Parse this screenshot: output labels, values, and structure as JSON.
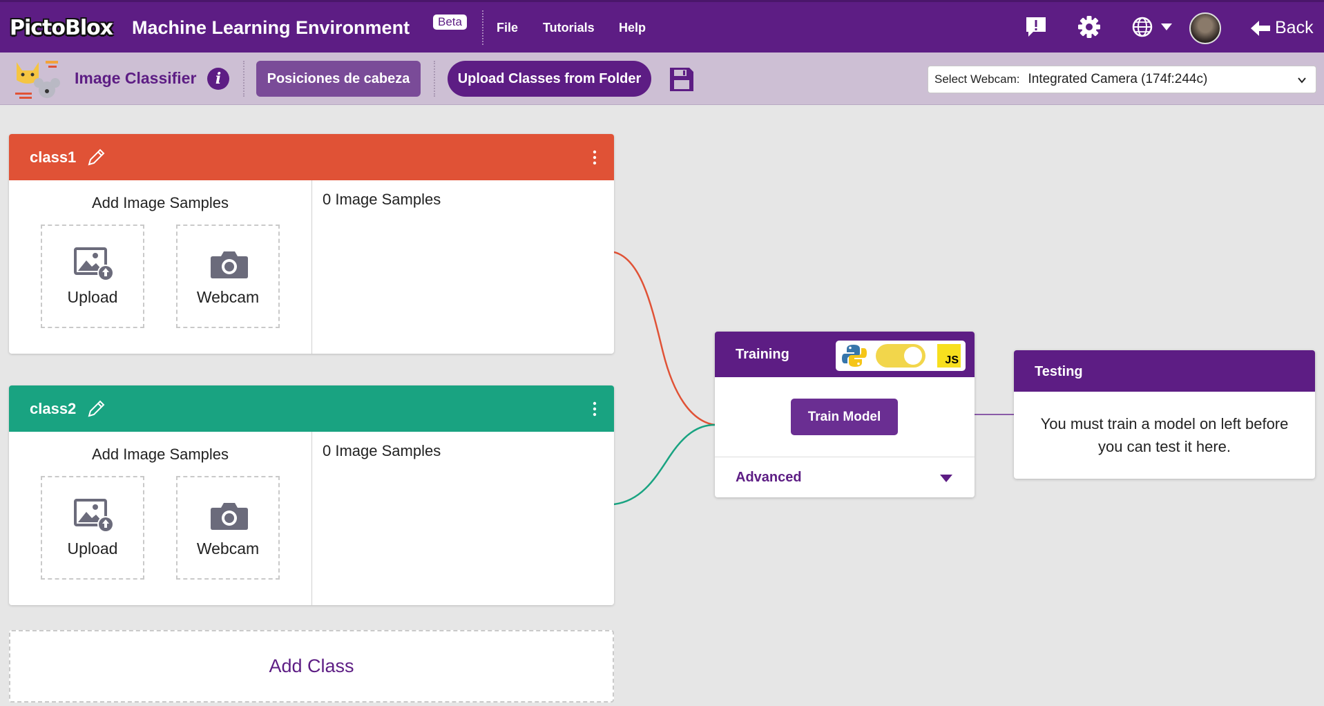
{
  "header": {
    "logo": "PictoBlox",
    "title": "Machine Learning Environment",
    "beta": "Beta",
    "menu": [
      "File",
      "Tutorials",
      "Help"
    ],
    "back_label": "Back",
    "icons": [
      "feedback-icon",
      "gear-icon",
      "globe-icon",
      "caret-down-icon",
      "avatar",
      "arrow-left-icon"
    ]
  },
  "toolbar": {
    "project_type": "Image Classifier",
    "project_name_button": "Posiciones de cabeza",
    "upload_button": "Upload Classes from Folder",
    "webcam_label": "Select Webcam:",
    "webcam_value": "Integrated Camera (174f:244c)"
  },
  "classes": [
    {
      "name": "class1",
      "color": "#e05236",
      "add_samples_label": "Add Image Samples",
      "upload_label": "Upload",
      "webcam_label": "Webcam",
      "samples_count": "0 Image Samples"
    },
    {
      "name": "class2",
      "color": "#19a381",
      "add_samples_label": "Add Image Samples",
      "upload_label": "Upload",
      "webcam_label": "Webcam",
      "samples_count": "0 Image Samples"
    }
  ],
  "add_class_label": "Add Class",
  "training": {
    "title": "Training",
    "python_toggle_on": true,
    "js_label": "JS",
    "train_button": "Train Model",
    "advanced_label": "Advanced"
  },
  "testing": {
    "title": "Testing",
    "message": "You must train a model on left before you can test it here."
  },
  "colors": {
    "brand_purple": "#5d1d84",
    "toolbar_bg": "#cdbfd4",
    "canvas_bg": "#e6e6e6"
  }
}
